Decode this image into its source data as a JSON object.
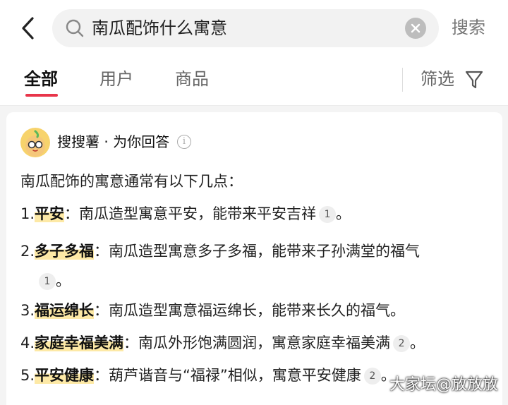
{
  "search": {
    "query": "南瓜配饰什么寓意",
    "button_label": "搜索"
  },
  "tabs": [
    {
      "label": "全部",
      "active": true
    },
    {
      "label": "用户",
      "active": false
    },
    {
      "label": "商品",
      "active": false
    }
  ],
  "filter": {
    "label": "筛选"
  },
  "answer_card": {
    "source": "搜搜薯 · 为你回答",
    "intro": "南瓜配饰的寓意通常有以下几点：",
    "items": [
      {
        "num": "1.",
        "key": "平安",
        "colon": "：",
        "text": "南瓜造型寓意平安，能带来平安吉祥",
        "cite": "1",
        "end": "。"
      },
      {
        "num": "2.",
        "key": "多子多福",
        "colon": "：",
        "text": "南瓜造型寓意多子多福，能带来子孙满堂的福气",
        "cite": "1",
        "end": "。"
      },
      {
        "num": "3.",
        "key": "福运绵长",
        "colon": "：",
        "text": "南瓜造型寓意福运绵长，能带来长久的福气。",
        "cite": "",
        "end": ""
      },
      {
        "num": "4.",
        "key": "家庭幸福美满",
        "colon": "：",
        "text": "南瓜外形饱满圆润，寓意家庭幸福美满",
        "cite": "2",
        "end": "。"
      },
      {
        "num": "5.",
        "key": "平安健康",
        "colon": "：",
        "text": "葫芦谐音与“福禄”相似，寓意平安健康",
        "cite": "2",
        "end": "。"
      }
    ]
  },
  "watermark": "大家坛@放放放",
  "colors": {
    "accent": "#e8354a",
    "highlight": "#fde9a6"
  }
}
